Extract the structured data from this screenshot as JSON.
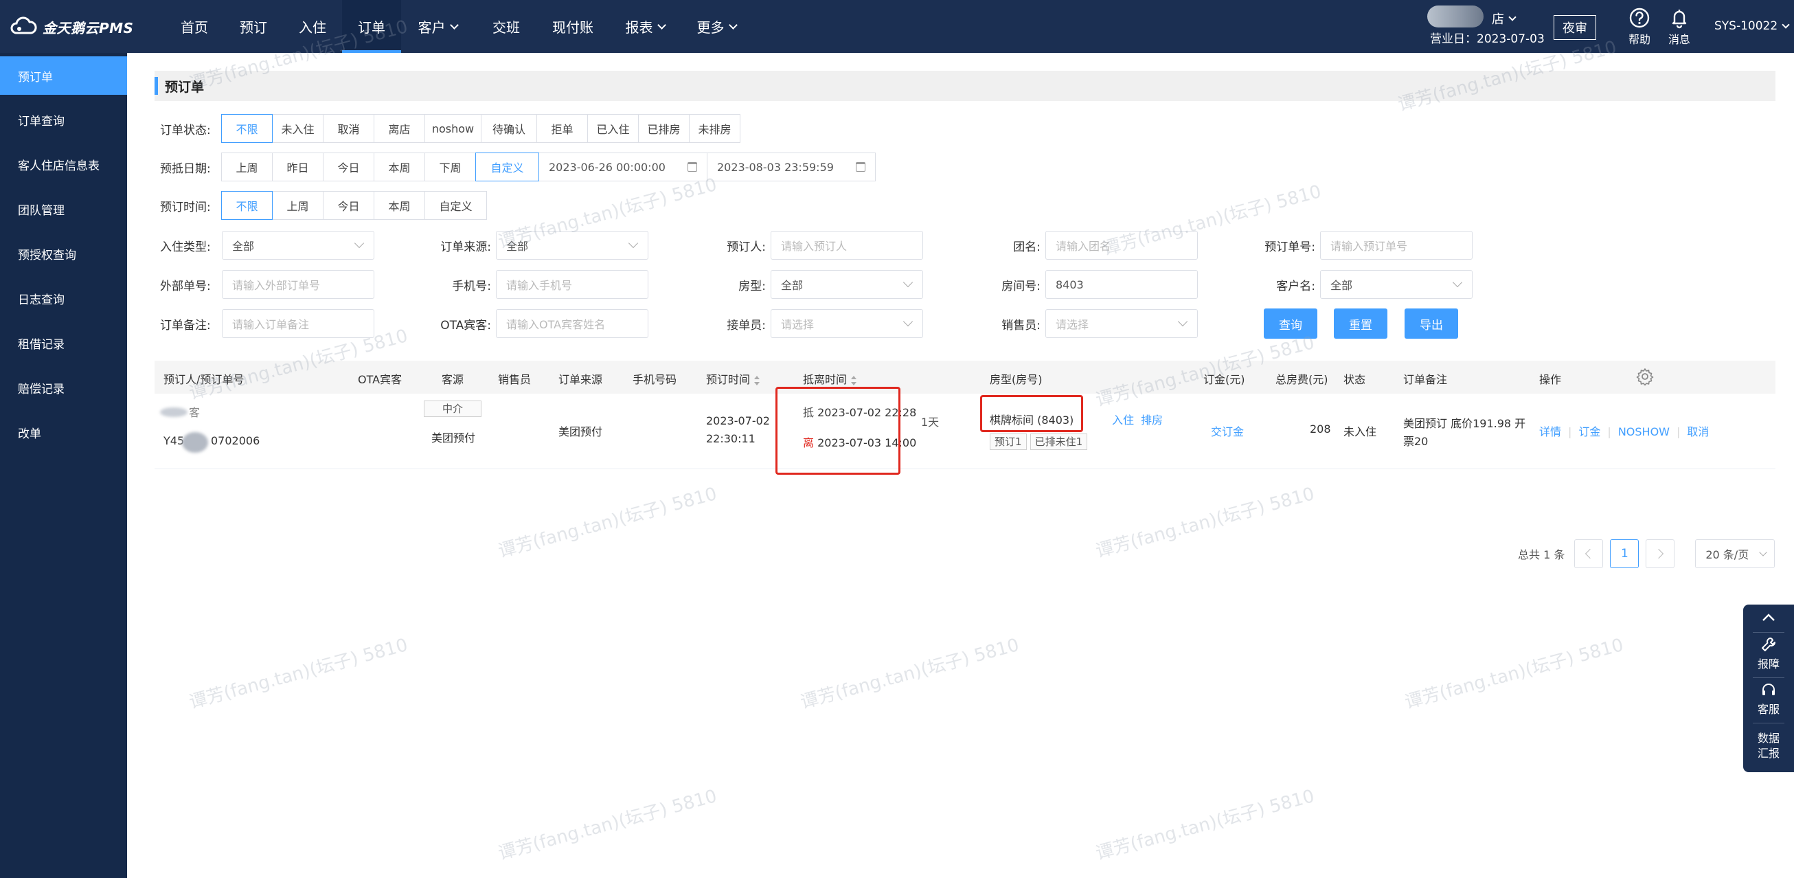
{
  "app": {
    "logo_text": "金天鹅云PMS"
  },
  "nav": {
    "items": [
      {
        "label": "首页",
        "dropdown": false
      },
      {
        "label": "预订",
        "dropdown": false
      },
      {
        "label": "入住",
        "dropdown": false
      },
      {
        "label": "订单",
        "dropdown": false,
        "active": true
      },
      {
        "label": "客户",
        "dropdown": true
      },
      {
        "label": "交班",
        "dropdown": false
      },
      {
        "label": "现付账",
        "dropdown": false
      },
      {
        "label": "报表",
        "dropdown": true
      },
      {
        "label": "更多",
        "dropdown": true
      }
    ]
  },
  "header": {
    "hotel_suffix": "店",
    "business_date": "营业日：2023-07-03",
    "night_audit": "夜审",
    "help": "帮助",
    "messages": "消息",
    "user": "SYS-10022"
  },
  "sidebar": {
    "items": [
      {
        "label": "预订单",
        "active": true
      },
      {
        "label": "订单查询"
      },
      {
        "label": "客人住店信息表"
      },
      {
        "label": "团队管理"
      },
      {
        "label": "预授权查询"
      },
      {
        "label": "日志查询"
      },
      {
        "label": "租借记录"
      },
      {
        "label": "赔偿记录"
      },
      {
        "label": "改单"
      }
    ]
  },
  "page": {
    "title": "预订单"
  },
  "filters": {
    "order_status": {
      "label": "订单状态:",
      "options": [
        "不限",
        "未入住",
        "取消",
        "离店",
        "noshow",
        "待确认",
        "拒单",
        "已入住",
        "已排房",
        "未排房"
      ],
      "active_index": 0
    },
    "arrive_date": {
      "label": "预抵日期:",
      "options": [
        "上周",
        "昨日",
        "今日",
        "本周",
        "下周",
        "自定义"
      ],
      "active_index": 5,
      "start": "2023-06-26 00:00:00",
      "end": "2023-08-03 23:59:59"
    },
    "booking_time": {
      "label": "预订时间:",
      "options": [
        "不限",
        "上周",
        "今日",
        "本周",
        "自定义"
      ],
      "active_index": 0
    },
    "checkin_type": {
      "label": "入住类型:",
      "value": "全部"
    },
    "order_source": {
      "label": "订单来源:",
      "value": "全部"
    },
    "booker": {
      "label": "预订人:",
      "placeholder": "请输入预订人"
    },
    "group_name": {
      "label": "团名:",
      "placeholder": "请输入团名"
    },
    "booking_no": {
      "label": "预订单号:",
      "placeholder": "请输入预订单号"
    },
    "external_no": {
      "label": "外部单号:",
      "placeholder": "请输入外部订单号"
    },
    "phone": {
      "label": "手机号:",
      "placeholder": "请输入手机号"
    },
    "room_type": {
      "label": "房型:",
      "value": "全部"
    },
    "room_no": {
      "label": "房间号:",
      "value": "8403"
    },
    "customer": {
      "label": "客户名:",
      "value": "全部"
    },
    "remark": {
      "label": "订单备注:",
      "placeholder": "请输入订单备注"
    },
    "ota_guest": {
      "label": "OTA宾客:",
      "placeholder": "请输入OTA宾客姓名"
    },
    "receiver": {
      "label": "接单员:",
      "placeholder": "请选择"
    },
    "salesman": {
      "label": "销售员:",
      "placeholder": "请选择"
    },
    "buttons": {
      "query": "查询",
      "reset": "重置",
      "export": "导出"
    }
  },
  "table": {
    "columns": [
      "预订人/预订单号",
      "OTA宾客",
      "客源",
      "销售员",
      "订单来源",
      "手机号码",
      "预订时间",
      "抵离时间",
      "房型(房号)",
      "订金(元)",
      "总房费(元)",
      "状态",
      "订单备注",
      "操作"
    ],
    "rows": [
      {
        "booker": "客",
        "booking_no_prefix": "Y45",
        "booking_no_suffix": "0702006",
        "source_tag": "中介",
        "source": "美团预付",
        "order_source": "美团预付",
        "booking_time_date": "2023-07-02",
        "booking_time_clock": "22:30:11",
        "arrive_label": "抵",
        "arrive": "2023-07-02 22:28",
        "depart_label": "离",
        "depart": "2023-07-03 14:00",
        "nights": "1天",
        "room": "棋牌标间 (8403)",
        "room_checkin": "入住",
        "room_assign": "排房",
        "room_tag1": "预订1",
        "room_tag2": "已排未住1",
        "deposit": "交订金",
        "total": "208",
        "status": "未入住",
        "remark_line1": "美团预订 底价191.98 开",
        "remark_line2": "票20",
        "actions": [
          "详情",
          "订金",
          "NOSHOW",
          "取消"
        ]
      }
    ]
  },
  "pagination": {
    "total": "总共 1 条",
    "current_page": "1",
    "page_size": "20 条/页"
  },
  "float_panel": {
    "report": "报障",
    "service": "客服",
    "data_line1": "数据",
    "data_line2": "汇报"
  },
  "watermark": "谭芳(fang.tan)(坛子) 5810",
  "colors": {
    "nav_bg": "#1b2f52",
    "accent": "#409eff",
    "highlight_red": "#e0281f"
  }
}
